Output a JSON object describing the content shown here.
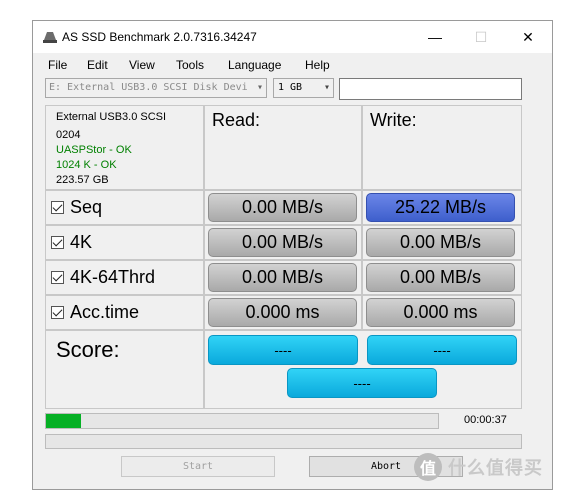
{
  "window": {
    "title": "AS SSD Benchmark 2.0.7316.34247",
    "controls": {
      "minimize": "—",
      "maximize": "☐",
      "close": "✕"
    }
  },
  "menu": {
    "items": [
      "File",
      "Edit",
      "View",
      "Tools",
      "Language",
      "Help"
    ]
  },
  "toolbar": {
    "drive": "E: External USB3.0 SCSI Disk Devi",
    "test_size": "1 GB",
    "text_box_value": "",
    "dropdown_icon": "chevron-down-icon"
  },
  "info": {
    "device": "External USB3.0 SCSI",
    "firmware": "0204",
    "driver_status": "UASPStor - OK",
    "alignment_status": "1024 K - OK",
    "capacity": "223.57 GB",
    "ok_color": "#008000"
  },
  "columns": {
    "read": "Read:",
    "write": "Write:"
  },
  "rows": [
    {
      "label": "Seq",
      "checked": true,
      "read": "0.00 MB/s",
      "write": "25.22 MB/s"
    },
    {
      "label": "4K",
      "checked": true,
      "read": "0.00 MB/s",
      "write": "0.00 MB/s"
    },
    {
      "label": "4K-64Thrd",
      "checked": true,
      "read": "0.00 MB/s",
      "write": "0.00 MB/s"
    },
    {
      "label": "Acc.time",
      "checked": true,
      "read": "0.000 ms",
      "write": "0.000 ms"
    }
  ],
  "score": {
    "label": "Score:",
    "read": "----",
    "write": "----",
    "total": "----"
  },
  "progress": {
    "value_fraction": 0.09,
    "elapsed": "00:00:37",
    "color": "#06b025"
  },
  "buttons": {
    "start": "Start",
    "abort": "Abort"
  },
  "colors": {
    "highlight_result": "#4a6ad6",
    "score_box": "#1bbfe9"
  },
  "watermark": {
    "text": "什么值得买",
    "icon": "值"
  }
}
